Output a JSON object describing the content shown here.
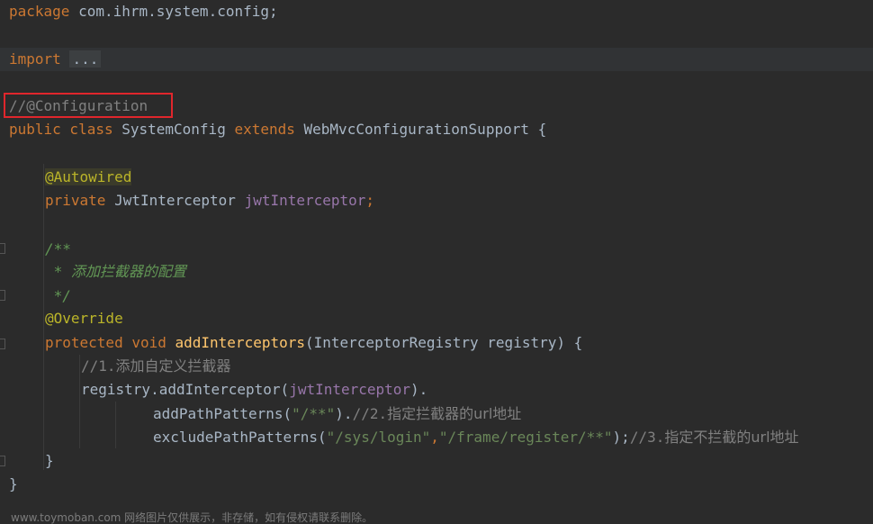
{
  "lines": {
    "l1": {
      "kw": "package",
      "rest": " com.ihrm.system.config;"
    },
    "l2": {
      "kw": "import",
      "fold": "..."
    },
    "l3": {
      "comment": "//@Configuration"
    },
    "l4": {
      "kw1": "public class",
      "cls": " SystemConfig ",
      "kw2": "extends",
      "rest": " WebMvcConfigurationSupport {"
    },
    "l5": {
      "ann": "@Autowired"
    },
    "l6": {
      "kw": "private",
      "type": " JwtInterceptor ",
      "field": "jwtInterceptor",
      "semi": ";"
    },
    "l7": {
      "doc": "/**"
    },
    "l8": {
      "doc_star": " * ",
      "doc_text": "添加拦截器的配置"
    },
    "l9": {
      "doc": " */"
    },
    "l10": {
      "ann": "@Override"
    },
    "l11": {
      "kw": "protected void",
      "fn": "addInterceptors",
      "params": "(InterceptorRegistry registry) {"
    },
    "l12": {
      "comment_prefix": "//1.",
      "comment_text": "添加自定义拦截器"
    },
    "l13": {
      "pre": "registry.addInterceptor(",
      "field": "jwtInterceptor",
      "post": ")."
    },
    "l14": {
      "pre": "addPathPatterns(",
      "str": "\"/**\"",
      "mid": ").",
      "comment_prefix": "//2.",
      "comment_text": "指定拦截器的url地址"
    },
    "l15": {
      "pre": "excludePathPatterns(",
      "str1": "\"/sys/login\"",
      "comma": ",",
      "str2": "\"/frame/register/**\"",
      "mid": ");",
      "comment_prefix": "//3.",
      "comment_text": "指定不拦截的url地址"
    },
    "l16": {
      "brace": "}"
    },
    "l17": {
      "brace": "}"
    }
  },
  "watermark": "www.toymoban.com 网络图片仅供展示，非存储，如有侵权请联系删除。",
  "colors": {
    "background": "#2b2b2b",
    "keyword": "#cc7832",
    "annotation": "#bbb529",
    "comment": "#808080",
    "doc_comment": "#629755",
    "field": "#9876aa",
    "method": "#ffc66d",
    "string": "#6a8759",
    "text": "#a9b7c6",
    "highlight_border": "#e0262c"
  }
}
